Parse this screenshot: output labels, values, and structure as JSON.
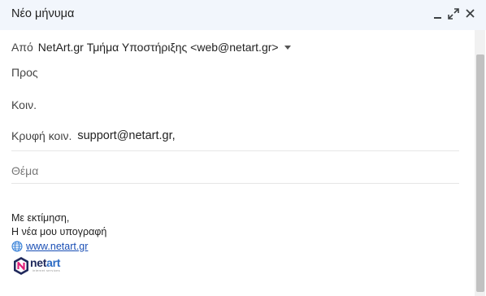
{
  "window": {
    "title": "Νέο μήνυμα",
    "icons": [
      "minimize-icon",
      "expand-icon",
      "close-icon"
    ]
  },
  "compose": {
    "from_label": "Από",
    "from_value": "NetArt.gr Τμήμα Υποστήριξης <web@netart.gr>",
    "to_label": "Προς",
    "cc_label": "Κοιν.",
    "bcc_label": "Κρυφή κοιν.",
    "bcc_value": "support@netart.gr,",
    "subject_placeholder": "Θέμα",
    "subject_value": ""
  },
  "signature": {
    "line1": "Με εκτίμηση,",
    "line2": "Η νέα μου υπογραφή",
    "link_text": "www.netart.gr",
    "link_icon": "globe-icon",
    "logo": {
      "name": "netart-logo",
      "word_part1": "net",
      "word_part2": "art",
      "tagline": "internet services"
    }
  },
  "colors": {
    "titlebar_bg": "#f2f6fc",
    "link": "#1a4fb5",
    "logo_dark": "#20295c",
    "logo_accent": "#2b6bc4"
  }
}
